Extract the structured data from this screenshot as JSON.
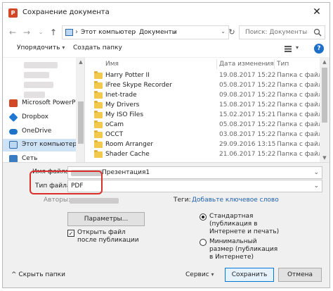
{
  "window": {
    "title": "Сохранение документа",
    "app_icon": "P"
  },
  "address": {
    "crumbs": [
      "Этот компьютер",
      "Документы"
    ],
    "search_placeholder": "Поиск: Документы"
  },
  "toolbar": {
    "organize_label": "Упорядочить",
    "new_folder_label": "Создать папку"
  },
  "sidebar": {
    "items": [
      {
        "label": "Microsoft PowerP",
        "icon": "powerpoint-icon",
        "color": "#d24726"
      },
      {
        "label": "Dropbox",
        "icon": "dropbox-icon",
        "color": "#1f78d1"
      },
      {
        "label": "OneDrive",
        "icon": "onedrive-icon",
        "color": "#1e73c8"
      },
      {
        "label": "Этот компьютер",
        "icon": "computer-icon",
        "color": "#2f6aa8"
      },
      {
        "label": "Сеть",
        "icon": "network-icon",
        "color": "#3a7cc1"
      }
    ]
  },
  "columns": {
    "name": "Имя",
    "date": "Дата изменения",
    "type": "Тип"
  },
  "files": [
    {
      "name": "Harry Potter II",
      "date": "19.08.2017 15:22",
      "type": "Папка с файлами"
    },
    {
      "name": "iFree Skype Recorder",
      "date": "05.08.2017 15:22",
      "type": "Папка с файлами"
    },
    {
      "name": "Inet-trade",
      "date": "09.08.2017 15:22",
      "type": "Папка с файлами"
    },
    {
      "name": "My Drivers",
      "date": "15.08.2017 15:22",
      "type": "Папка с файлами"
    },
    {
      "name": "My ISO Files",
      "date": "15.02.2017 15:21",
      "type": "Папка с файлами"
    },
    {
      "name": "oCam",
      "date": "05.08.2017 15:22",
      "type": "Папка с файлами"
    },
    {
      "name": "OCCT",
      "date": "03.08.2017 15:22",
      "type": "Папка с файлами"
    },
    {
      "name": "Room Arranger",
      "date": "29.09.2016 13:15",
      "type": "Папка с файлами"
    },
    {
      "name": "Shader Cache",
      "date": "21.06.2017 15:22",
      "type": "Папка с файлами"
    }
  ],
  "form": {
    "filename_label": "Имя файла:",
    "filename_value": "Презентация1",
    "filetype_label": "Тип файла:",
    "filetype_value": "PDF",
    "authors_label": "Авторы:",
    "tags_label": "Теги:",
    "tags_link": "Добавьте ключевое слово",
    "params_button": "Параметры...",
    "open_after_label": "Открыть файл после публикации",
    "open_after_checked": true,
    "radio_standard": "Стандартная (публикация в Интернете и печать)",
    "radio_minimal": "Минимальный размер (публикация в Интернете)"
  },
  "footer": {
    "hide_folders": "Скрыть папки",
    "service": "Сервис",
    "save": "Сохранить",
    "cancel": "Отмена"
  }
}
